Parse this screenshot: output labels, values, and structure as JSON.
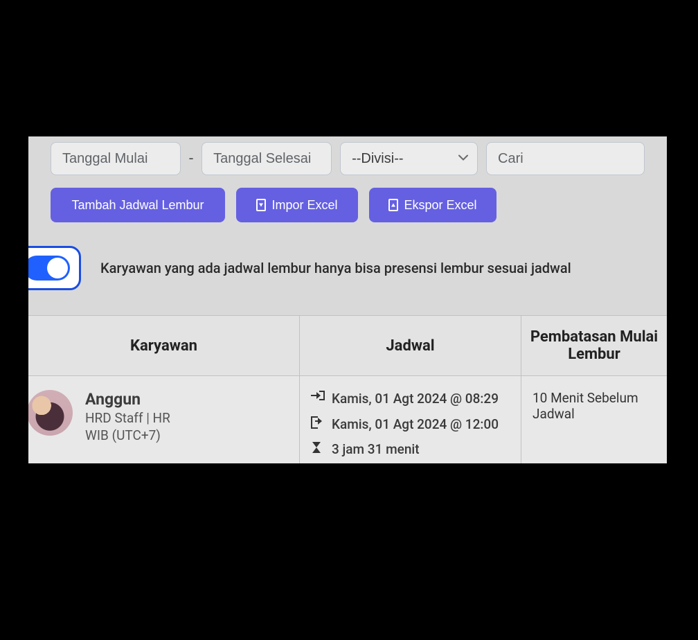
{
  "filters": {
    "start_date_placeholder": "Tanggal Mulai",
    "end_date_placeholder": "Tanggal Selesai",
    "division_selected": "--Divisi--",
    "search_placeholder": "Cari"
  },
  "actions": {
    "add_schedule_label": "Tambah Jadwal Lembur",
    "import_label": "Impor Excel",
    "export_label": "Ekspor Excel"
  },
  "toggle": {
    "state": "on",
    "caption": "Karyawan yang ada jadwal lembur hanya bisa presensi lembur sesuai jadwal"
  },
  "table": {
    "headers": {
      "employee": "Karyawan",
      "schedule": "Jadwal",
      "restriction": "Pembatasan Mulai Lembur"
    },
    "rows": [
      {
        "employee": {
          "name": "Anggun",
          "role": "HRD Staff | HR",
          "timezone": "WIB (UTC+7)"
        },
        "schedule": {
          "in": "Kamis, 01 Agt 2024 @ 08:29",
          "out": "Kamis, 01 Agt 2024 @ 12:00",
          "duration": "3 jam 31 menit"
        },
        "restriction": "10 Menit Sebelum Jadwal"
      }
    ]
  },
  "icons": {
    "chevron_down": "chevron-down-icon",
    "file_import": "file-import-icon",
    "file_export": "file-export-icon",
    "sign_in": "sign-in-icon",
    "sign_out": "sign-out-icon",
    "hourglass": "hourglass-icon"
  }
}
